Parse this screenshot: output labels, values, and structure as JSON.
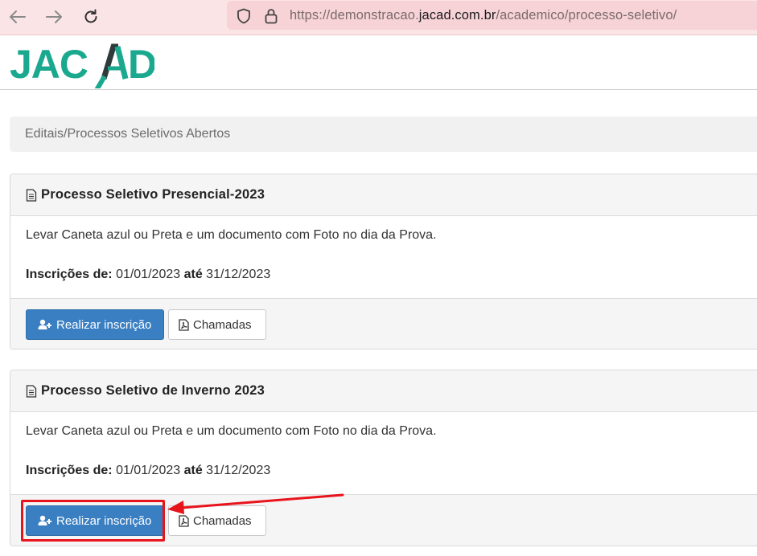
{
  "browser": {
    "url_prefix": "https://demonstracao.",
    "url_domain": "jacad.com.br",
    "url_path": "/academico/processo-seletivo/",
    "icons": [
      "back-arrow-icon",
      "forward-arrow-icon",
      "reload-icon",
      "shield-icon",
      "lock-icon"
    ]
  },
  "header": {
    "logo_text": "JACAD",
    "brand_color": "#1aa88f"
  },
  "breadcrumb": {
    "text": "Editais/Processos Seletivos Abertos"
  },
  "processes": [
    {
      "title": "Processo Seletivo Presencial-2023",
      "description": "Levar Caneta azul ou Preta e um documento com Foto no dia da Prova.",
      "dates_label": "Inscrições de:",
      "date_start": "01/01/2023",
      "dates_sep": "até",
      "date_end": "31/12/2023",
      "register_label": "Realizar inscrição",
      "calls_label": "Chamadas"
    },
    {
      "title": "Processo Seletivo de Inverno 2023",
      "description": "Levar Caneta azul ou Preta e um documento com Foto no dia da Prova.",
      "dates_label": "Inscrições de:",
      "date_start": "01/01/2023",
      "dates_sep": "até",
      "date_end": "31/12/2023",
      "register_label": "Realizar inscrição",
      "calls_label": "Chamadas"
    }
  ],
  "colors": {
    "primary_button": "#3a7fc2",
    "annotation": "#e8141c"
  }
}
